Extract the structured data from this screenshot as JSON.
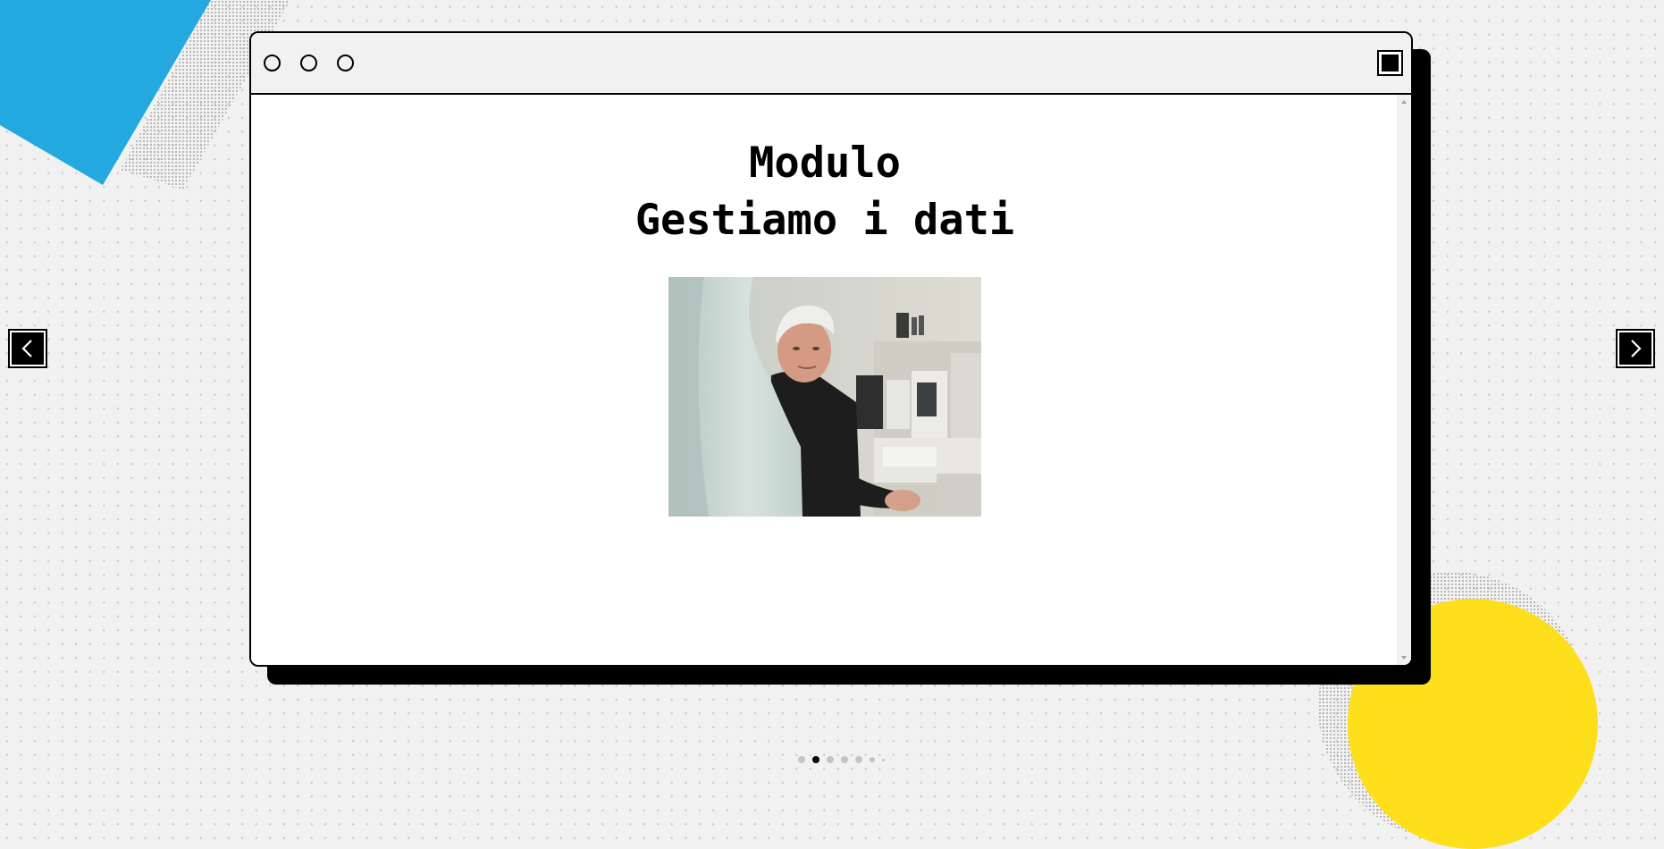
{
  "page": {
    "title_line1": "Modulo",
    "title_line2": "Gestiamo i dati"
  },
  "window": {
    "controls": [
      "circle-button",
      "circle-button",
      "circle-button"
    ],
    "maximize_icon": "maximize-square-icon"
  },
  "navigation": {
    "prev_icon": "chevron-left-icon",
    "next_icon": "chevron-right-icon"
  },
  "pagination": {
    "total": 7,
    "current": 2
  },
  "colors": {
    "background": "#f1f1f1",
    "accent_blue": "#23a8e0",
    "accent_yellow": "#fde01b",
    "frame": "#000000"
  }
}
